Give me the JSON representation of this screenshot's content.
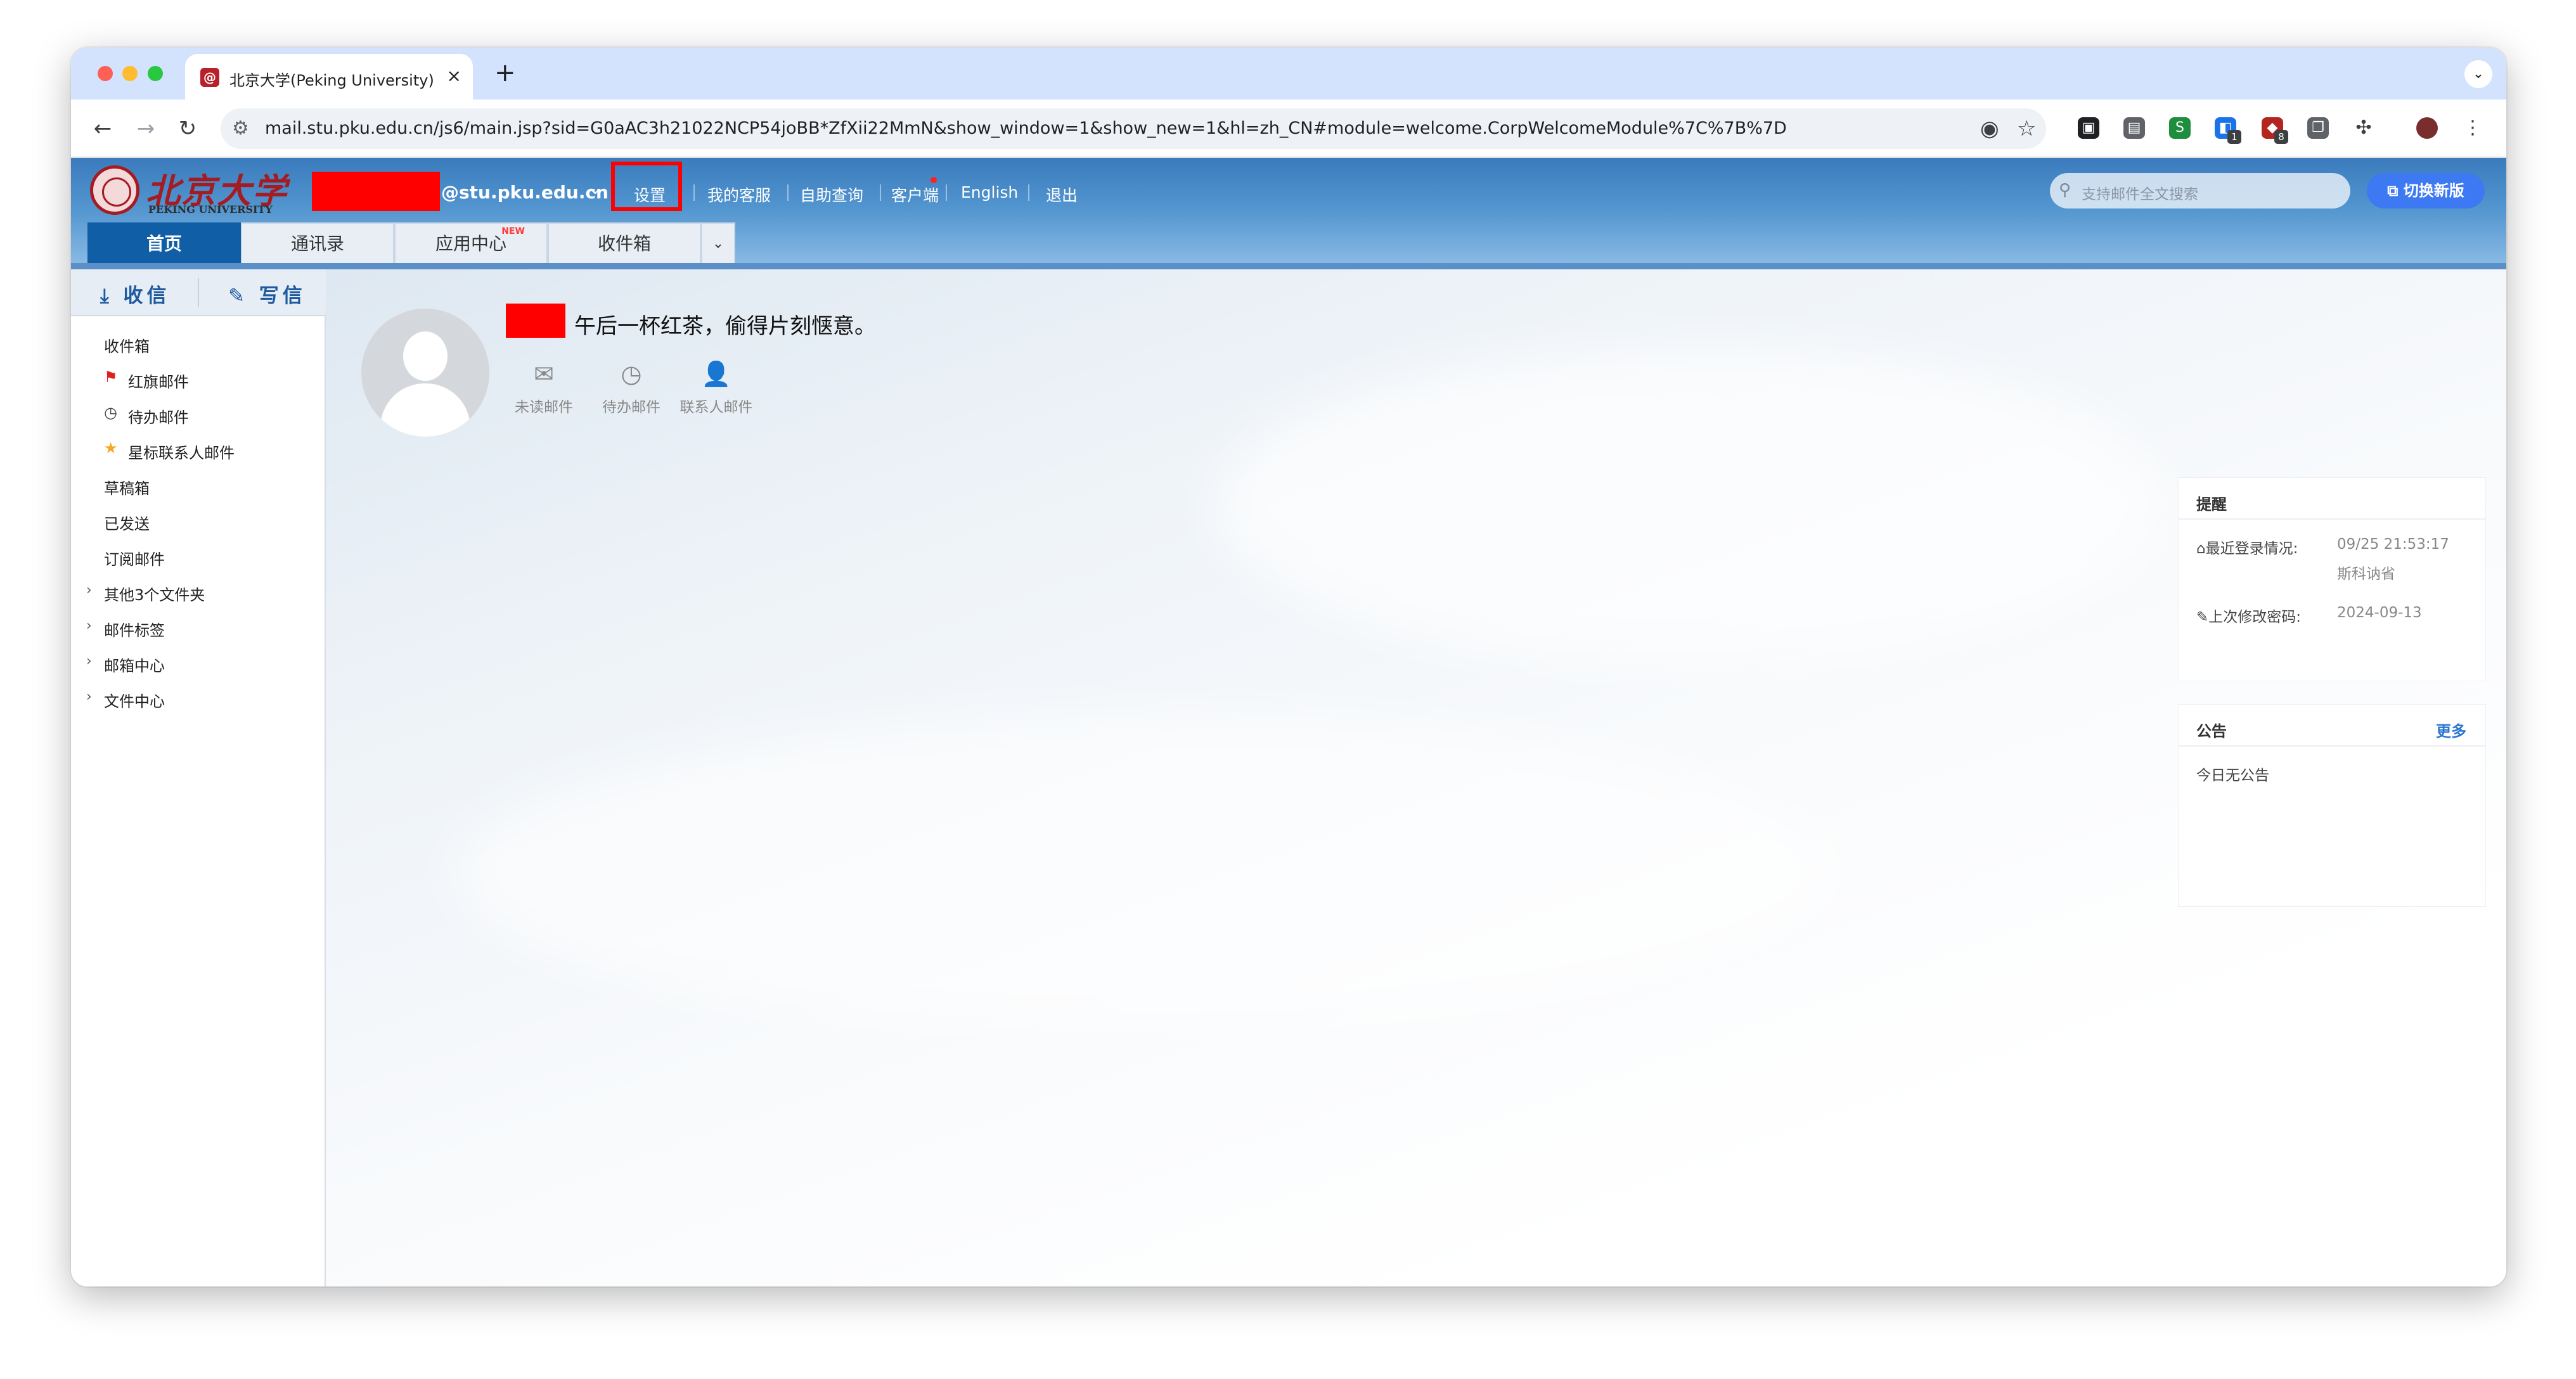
{
  "browser": {
    "tab_title": "北京大学(Peking University)",
    "tab_favicon": "@",
    "new_tab": "+",
    "url": "mail.stu.pku.edu.cn/js6/main.jsp?sid=G0aAC3h21022NCP54joBB*ZfXii22MmN&show_window=1&show_new=1&hl=zh_CN#module=welcome.CorpWelcomeModule%7C%7B%7D",
    "ext_badges": [
      "1",
      "8"
    ]
  },
  "header": {
    "logo_cn": "北京大学",
    "logo_en": "PEKING UNIVERSITY",
    "user_domain": "@stu.pku.edu.cn",
    "links": {
      "settings": "设置",
      "service": "我的客服",
      "selfquery": "自助查询",
      "client": "客户端",
      "english": "English",
      "logout": "退出"
    },
    "search_placeholder": "支持邮件全文搜索",
    "switch_label": "切换新版"
  },
  "nav_tabs": {
    "home": "首页",
    "contacts": "通讯录",
    "apps": "应用中心",
    "apps_badge": "NEW",
    "inbox": "收件箱"
  },
  "sidebar": {
    "receive": "收信",
    "compose": "写信",
    "folders": {
      "inbox": "收件箱",
      "flagged": "红旗邮件",
      "todo": "待办邮件",
      "starred": "星标联系人邮件",
      "drafts": "草稿箱",
      "sent": "已发送",
      "subscribed": "订阅邮件",
      "other": "其他3个文件夹",
      "labels": "邮件标签",
      "mailcenter": "邮箱中心",
      "filecenter": "文件中心"
    }
  },
  "welcome": {
    "greeting": "午后一杯红茶，偷得片刻惬意。",
    "quick": {
      "unread": "未读邮件",
      "todo": "待办邮件",
      "contact": "联系人邮件"
    }
  },
  "reminder": {
    "title": "提醒",
    "last_login_label": "最近登录情况:",
    "last_login_time": "09/25 21:53:17",
    "last_login_place": "斯科讷省",
    "last_pwd_label": "上次修改密码:",
    "last_pwd_date": "2024-09-13"
  },
  "notice": {
    "title": "公告",
    "more": "更多",
    "empty": "今日无公告"
  },
  "colors": {
    "header_blue": "#3b7bbd",
    "active_tab": "#0f5ea6",
    "logo_red": "#a41c22",
    "redaction": "#ff0000",
    "switch_button": "#3d79f2"
  }
}
